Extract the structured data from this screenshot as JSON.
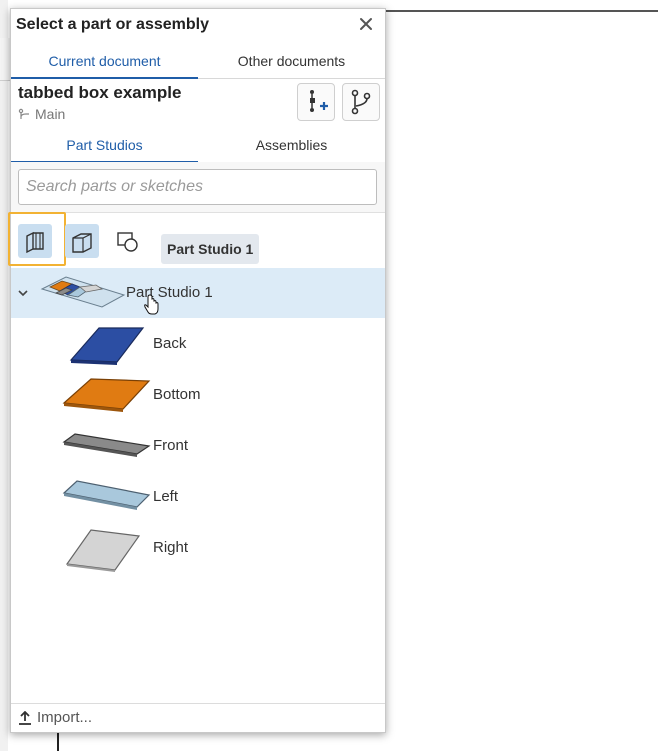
{
  "dialog": {
    "title": "Select a part or assembly",
    "tabs": [
      {
        "label": "Current document",
        "active": true
      },
      {
        "label": "Other documents",
        "active": false
      }
    ],
    "document": {
      "name": "tabbed box example",
      "branch": "Main"
    },
    "subtabs": [
      {
        "label": "Part Studios",
        "active": true
      },
      {
        "label": "Assemblies",
        "active": false
      }
    ],
    "search": {
      "placeholder": "Search parts or sketches"
    },
    "tooltip": "Part Studio 1",
    "studio": {
      "label": "Part Studio 1"
    },
    "parts": [
      {
        "label": "Back",
        "color": "#2c4ea3"
      },
      {
        "label": "Bottom",
        "color": "#e07b12"
      },
      {
        "label": "Front",
        "color": "#8a8a8a"
      },
      {
        "label": "Left",
        "color": "#a9c8dc"
      },
      {
        "label": "Right",
        "color": "#d4d4d4"
      }
    ],
    "footer": {
      "import_label": "Import..."
    }
  },
  "colors": {
    "accent": "#1f5da8",
    "selected_row": "#dcebf7",
    "highlight": "#f2b233"
  },
  "icons": [
    "close-icon",
    "insert-icon",
    "branch-icon",
    "parts-filter-icon",
    "surfaces-filter-icon",
    "sketch-filter-icon",
    "chevron-down-icon",
    "cursor-hand-icon",
    "upload-icon"
  ]
}
